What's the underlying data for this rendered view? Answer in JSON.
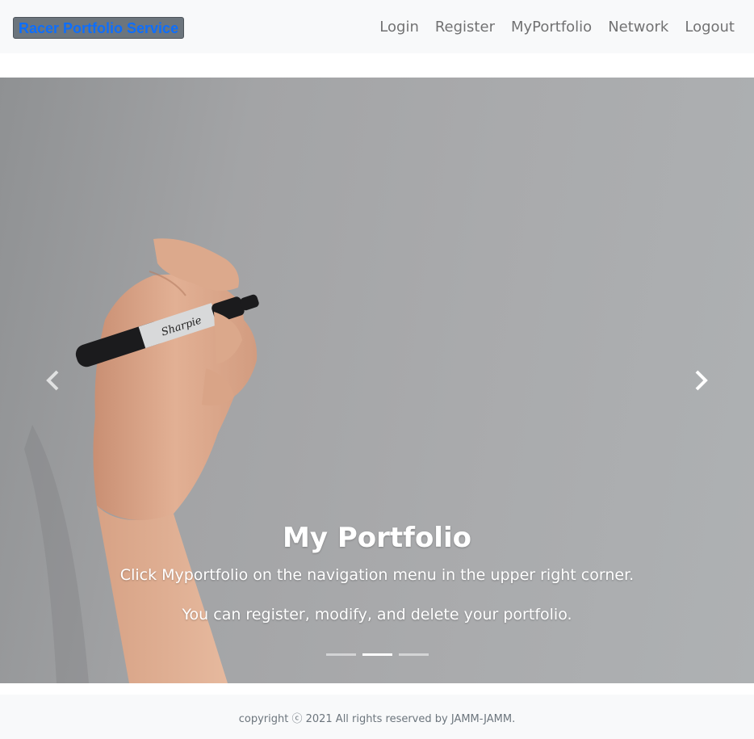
{
  "navbar": {
    "brand": "Racer Portfolio Service",
    "links": [
      "Login",
      "Register",
      "MyPortfolio",
      "Network",
      "Logout"
    ]
  },
  "carousel": {
    "title": "My Portfolio",
    "line1": "Click Myportfolio on the navigation menu in the upper right corner.",
    "line2": "You can register, modify, and delete your portfolio.",
    "slides": 3,
    "active_slide": 2
  },
  "footer": {
    "text": "copyright ⓒ 2021 All rights reserved by JAMM-JAMM."
  }
}
